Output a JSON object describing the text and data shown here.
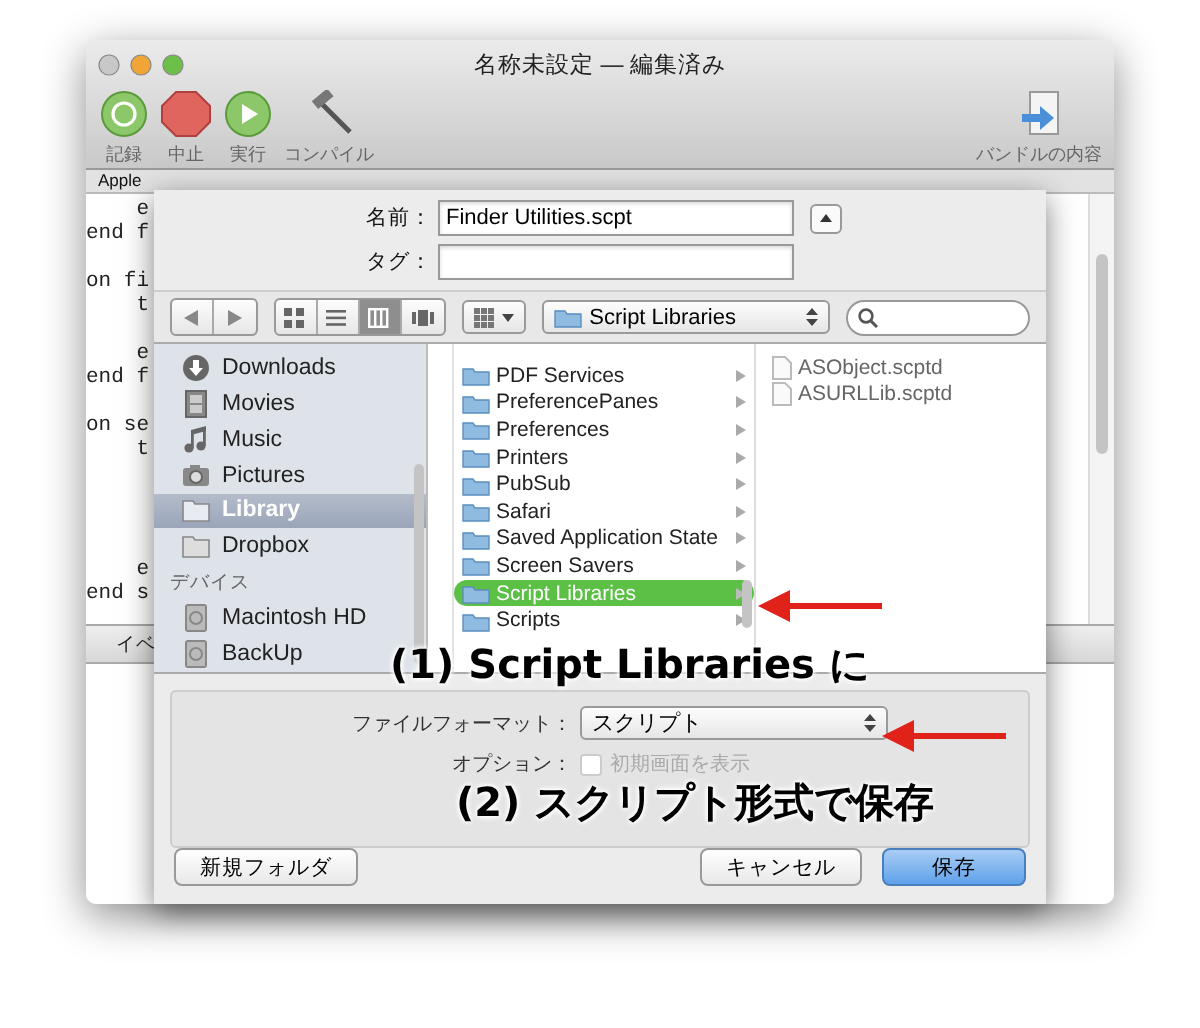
{
  "window": {
    "title": "名称未設定 — 編集済み",
    "toolbar": [
      {
        "label": "記録",
        "kind": "record"
      },
      {
        "label": "中止",
        "kind": "stop"
      },
      {
        "label": "実行",
        "kind": "run"
      },
      {
        "label": "コンパイル",
        "kind": "compile"
      }
    ],
    "bundle_button": {
      "label": "バンドルの内容"
    },
    "navigation_bar": {
      "text": "Apple"
    },
    "code_lines": [
      {
        "kind": "code",
        "text": "e",
        "indented": true
      },
      {
        "kind": "code",
        "text": "end f",
        "indented": false
      },
      {
        "kind": "blank"
      },
      {
        "kind": "code",
        "text": "on fi",
        "indented": false
      },
      {
        "kind": "code",
        "text": "t",
        "indented": true
      },
      {
        "kind": "blank"
      },
      {
        "kind": "code",
        "text": "e",
        "indented": true
      },
      {
        "kind": "code",
        "text": "end f",
        "indented": false
      },
      {
        "kind": "blank"
      },
      {
        "kind": "code",
        "text": "on se",
        "indented": false
      },
      {
        "kind": "code",
        "text": "t",
        "indented": true
      },
      {
        "kind": "blank"
      },
      {
        "kind": "blank"
      },
      {
        "kind": "blank"
      },
      {
        "kind": "blank"
      },
      {
        "kind": "code",
        "text": "e",
        "indented": true
      },
      {
        "kind": "code",
        "text": "end s",
        "indented": false
      }
    ],
    "bottom_tab": {
      "label": "イベ"
    }
  },
  "save_sheet": {
    "name_label": "名前：",
    "name_value": "Finder Utilities.scpt",
    "tag_label": "タグ：",
    "view_modes": [
      {
        "kind": "icons",
        "selected": false
      },
      {
        "kind": "list",
        "selected": false
      },
      {
        "kind": "columns",
        "selected": true
      },
      {
        "kind": "coverflow",
        "selected": false
      }
    ],
    "location": "Script Libraries",
    "sidebar": {
      "sections": [
        {
          "items": [
            {
              "label": "Downloads",
              "kind": "downloads",
              "selected": false
            },
            {
              "label": "Movies",
              "kind": "movies",
              "selected": false
            },
            {
              "label": "Music",
              "kind": "music",
              "selected": false
            },
            {
              "label": "Pictures",
              "kind": "pictures",
              "selected": false
            },
            {
              "label": "Library",
              "kind": "folder",
              "selected": true
            },
            {
              "label": "Dropbox",
              "kind": "folder",
              "selected": false
            }
          ]
        },
        {
          "title": "デバイス",
          "items": [
            {
              "label": "Macintosh HD",
              "kind": "disk",
              "selected": false
            },
            {
              "label": "BackUp",
              "kind": "disk",
              "selected": false
            }
          ]
        }
      ]
    },
    "column_1": [
      {
        "label": "PDF Services",
        "selected": false
      },
      {
        "label": "PreferencePanes",
        "selected": false
      },
      {
        "label": "Preferences",
        "selected": false
      },
      {
        "label": "Printers",
        "selected": false
      },
      {
        "label": "PubSub",
        "selected": false
      },
      {
        "label": "Safari",
        "selected": false
      },
      {
        "label": "Saved Application State",
        "selected": false
      },
      {
        "label": "Screen Savers",
        "selected": false
      },
      {
        "label": "Script Libraries",
        "selected": true
      },
      {
        "label": "Scripts",
        "selected": false
      }
    ],
    "column_2": [
      {
        "label": "ASObject.scptd"
      },
      {
        "label": "ASURLLib.scptd"
      }
    ],
    "format_label": "ファイルフォーマット：",
    "format_value": "スクリプト",
    "options_label": "オプション：",
    "option": {
      "label": "初期画面を表示",
      "checked": false,
      "disabled": true
    },
    "buttons": [
      {
        "label": "新規フォルダ",
        "kind": "new_folder",
        "default": false
      },
      {
        "label": "キャンセル",
        "kind": "cancel",
        "default": false
      },
      {
        "label": "保存",
        "kind": "save",
        "default": true
      }
    ]
  },
  "annotations": [
    {
      "text": "(1) Script Libraries に"
    },
    {
      "text": "(2) スクリプト形式で保存"
    }
  ]
}
